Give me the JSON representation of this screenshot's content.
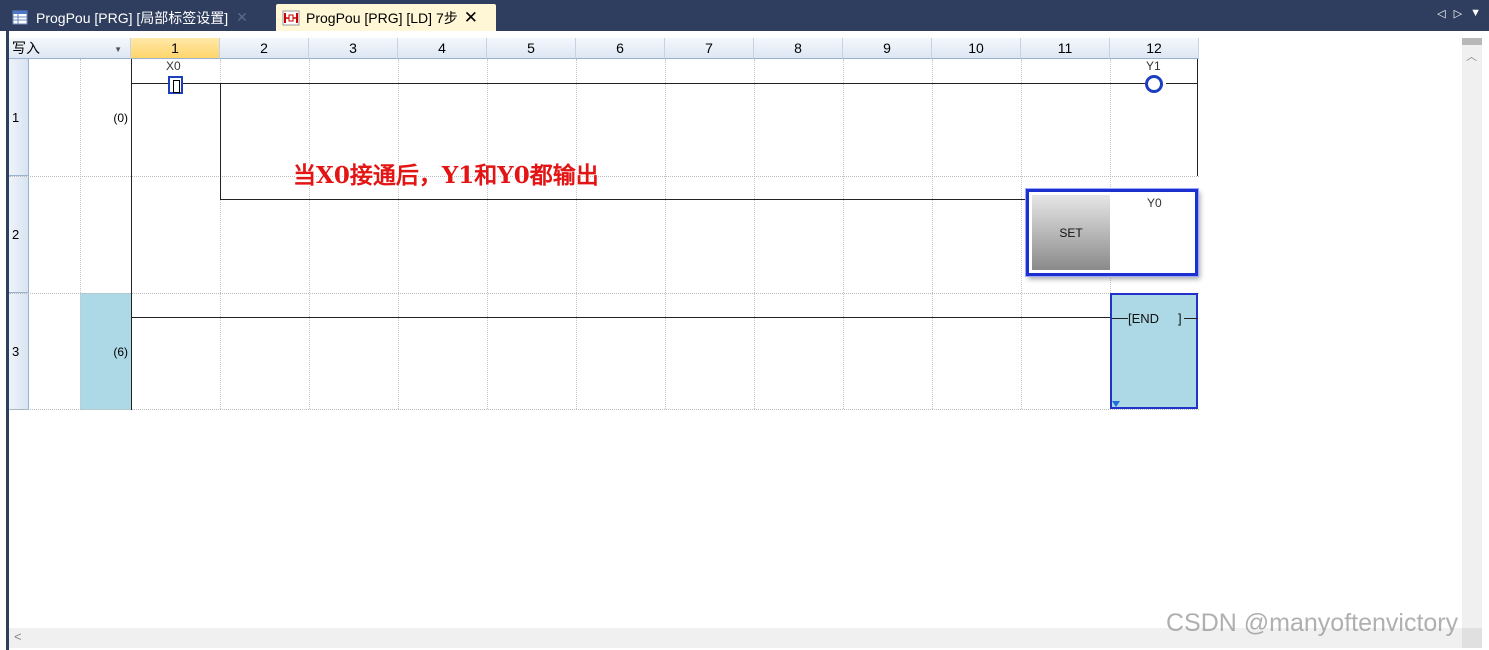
{
  "tabs": [
    {
      "label": "ProgPou [PRG] [局部标签设置]",
      "close": "✕"
    },
    {
      "label": "ProgPou [PRG] [LD] 7步",
      "close": "✕"
    }
  ],
  "tab_nav": {
    "prev": "◁",
    "next": "▷",
    "menu": "▼"
  },
  "toolbar": {
    "mode": "写入"
  },
  "columns": [
    "1",
    "2",
    "3",
    "4",
    "5",
    "6",
    "7",
    "8",
    "9",
    "10",
    "11",
    "12"
  ],
  "rows": [
    {
      "number": "1",
      "step": "(0)"
    },
    {
      "number": "2",
      "step": ""
    },
    {
      "number": "3",
      "step": "(6)"
    }
  ],
  "ladder": {
    "contact_label": "X0",
    "coil_label": "Y1",
    "set_instruction": "SET",
    "set_operand": "Y0",
    "end_instruction": "[END",
    "end_bracket": "]"
  },
  "annotation": "当X0接通后，Y1和Y0都输出",
  "watermark": "CSDN @manyoftenvictory",
  "colors": {
    "tabbar": "#2f3e5e",
    "active_tab": "#fff7d6",
    "selection_blue": "#1c2fcf",
    "end_fill": "#add8e6",
    "annotation_red": "#e31414"
  }
}
